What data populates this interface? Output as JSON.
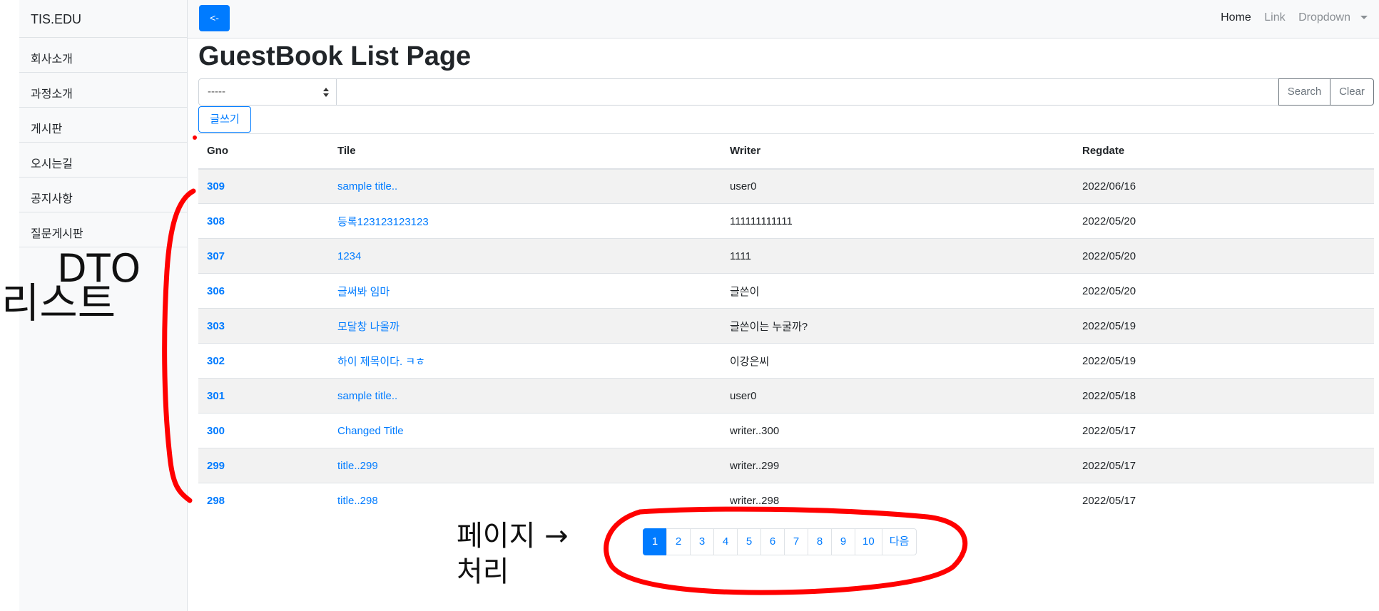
{
  "sidebar": {
    "brand": "TIS.EDU",
    "items": [
      {
        "label": "회사소개"
      },
      {
        "label": "과정소개"
      },
      {
        "label": "게시판"
      },
      {
        "label": "오시는길"
      },
      {
        "label": "공지사항"
      },
      {
        "label": "질문게시판"
      }
    ]
  },
  "topbar": {
    "back_label": "<-",
    "nav": {
      "home": "Home",
      "link": "Link",
      "dropdown": "Dropdown"
    }
  },
  "main": {
    "title": "GuestBook List Page",
    "search": {
      "select_value": "-----",
      "input_value": "",
      "search_label": "Search",
      "clear_label": "Clear"
    },
    "write_label": "글쓰기",
    "table": {
      "headers": {
        "gno": "Gno",
        "title": "Tile",
        "writer": "Writer",
        "regdate": "Regdate"
      },
      "rows": [
        {
          "gno": "309",
          "title": "sample title..",
          "writer": "user0",
          "regdate": "2022/06/16"
        },
        {
          "gno": "308",
          "title": "등록123123123123",
          "writer": "111111111111",
          "regdate": "2022/05/20"
        },
        {
          "gno": "307",
          "title": "1234",
          "writer": "1111",
          "regdate": "2022/05/20"
        },
        {
          "gno": "306",
          "title": "글써봐 임마",
          "writer": "글쓴이",
          "regdate": "2022/05/20"
        },
        {
          "gno": "303",
          "title": "모달창 나올까",
          "writer": "글쓴이는 누굴까?",
          "regdate": "2022/05/19"
        },
        {
          "gno": "302",
          "title": "하이 제목이다. ㅋㅎ",
          "writer": "이강은씨",
          "regdate": "2022/05/19"
        },
        {
          "gno": "301",
          "title": "sample title..",
          "writer": "user0",
          "regdate": "2022/05/18"
        },
        {
          "gno": "300",
          "title": "Changed Title",
          "writer": "writer..300",
          "regdate": "2022/05/17"
        },
        {
          "gno": "299",
          "title": "title..299",
          "writer": "writer..299",
          "regdate": "2022/05/17"
        },
        {
          "gno": "298",
          "title": "title..298",
          "writer": "writer..298",
          "regdate": "2022/05/17"
        }
      ]
    },
    "pagination": {
      "pages": [
        "1",
        "2",
        "3",
        "4",
        "5",
        "6",
        "7",
        "8",
        "9",
        "10"
      ],
      "active": "1",
      "next_label": "다음"
    }
  },
  "annotations": {
    "stroke_color": "#ff0000",
    "left_note": [
      "DTO",
      "리스트"
    ],
    "bottom_note": [
      "페이지 →",
      "처리"
    ]
  }
}
